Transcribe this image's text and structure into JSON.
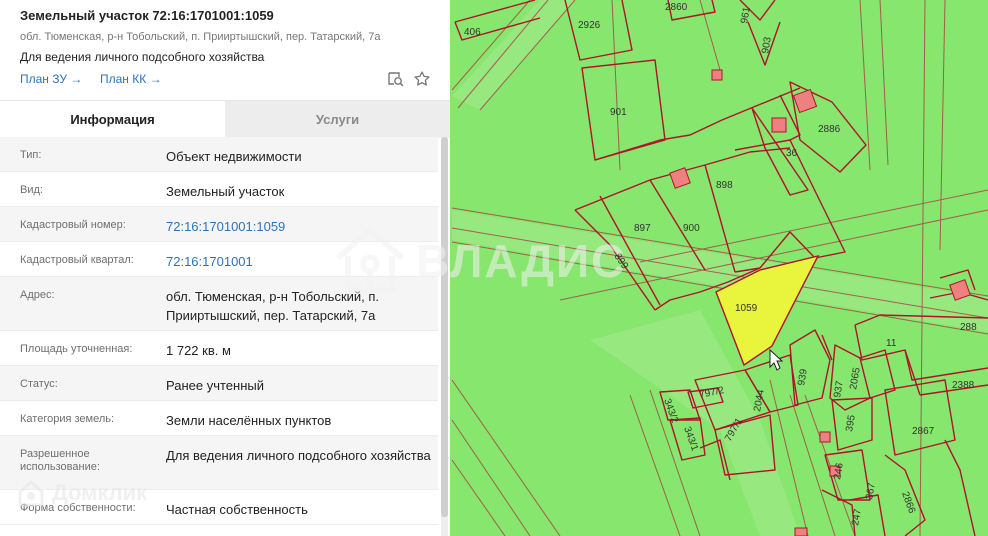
{
  "header": {
    "title": "Земельный участок 72:16:1701001:1059",
    "address": "обл. Тюменская, р-н Тобольский, п. Прииртышский, пер. Татарский, 7а",
    "use": "Для ведения личного подсобного хозяйства",
    "links": {
      "plan_zu": "План ЗУ →",
      "plan_kk": "План КК →"
    },
    "icons": {
      "search": "search-map-icon",
      "favorite": "star-icon"
    }
  },
  "tabs": {
    "info": "Информация",
    "services": "Услуги"
  },
  "fields": {
    "type": {
      "label": "Тип:",
      "value": "Объект недвижимости"
    },
    "kind": {
      "label": "Вид:",
      "value": "Земельный участок"
    },
    "cad_number": {
      "label": "Кадастровый номер:",
      "value": "72:16:1701001:1059"
    },
    "cad_quarter": {
      "label": "Кадастровый квартал:",
      "value": "72:16:1701001"
    },
    "address": {
      "label": "Адрес:",
      "value": "обл. Тюменская, р-н Тобольский, п. Прииртышский, пер. Татарский, 7а"
    },
    "area": {
      "label": "Площадь уточненная:",
      "value": "1 722 кв. м"
    },
    "status": {
      "label": "Статус:",
      "value": "Ранее учтенный"
    },
    "category": {
      "label": "Категория земель:",
      "value": "Земли населённых пунктов"
    },
    "permitted_use": {
      "label": "Разрешенное использование:",
      "value": "Для ведения личного подсобного хозяйства"
    },
    "ownership": {
      "label": "Форма собственности:",
      "value": "Частная собственность"
    }
  },
  "map": {
    "parcel_labels": {
      "p2926": "2926",
      "p2860": "2860",
      "p961": "961",
      "p406": "406",
      "p903": "903",
      "p901": "901",
      "p2886": "2886",
      "p36": "36",
      "p898": "898",
      "p897": "897",
      "p900": "900",
      "p899": "899",
      "p1059": "1059",
      "p288": "288",
      "p11": "11",
      "p2388": "2388",
      "p939": "939",
      "p2065": "2065",
      "p937": "937",
      "p797_2": "797/2",
      "p2044": "2044",
      "p343_2": "343/2",
      "p343_1": "343/1",
      "p797_1": "797/1",
      "p395": "395",
      "p2867": "2867",
      "p246": "246",
      "p367": "367",
      "p2866": "2866",
      "p247": "247"
    },
    "colors": {
      "land": "#86e66d",
      "border": "#b0132a",
      "selected": "#e8f53c",
      "building": "#ee8080"
    }
  },
  "watermarks": {
    "vladis": "ВЛАДИС",
    "domclick": "Домклик"
  }
}
